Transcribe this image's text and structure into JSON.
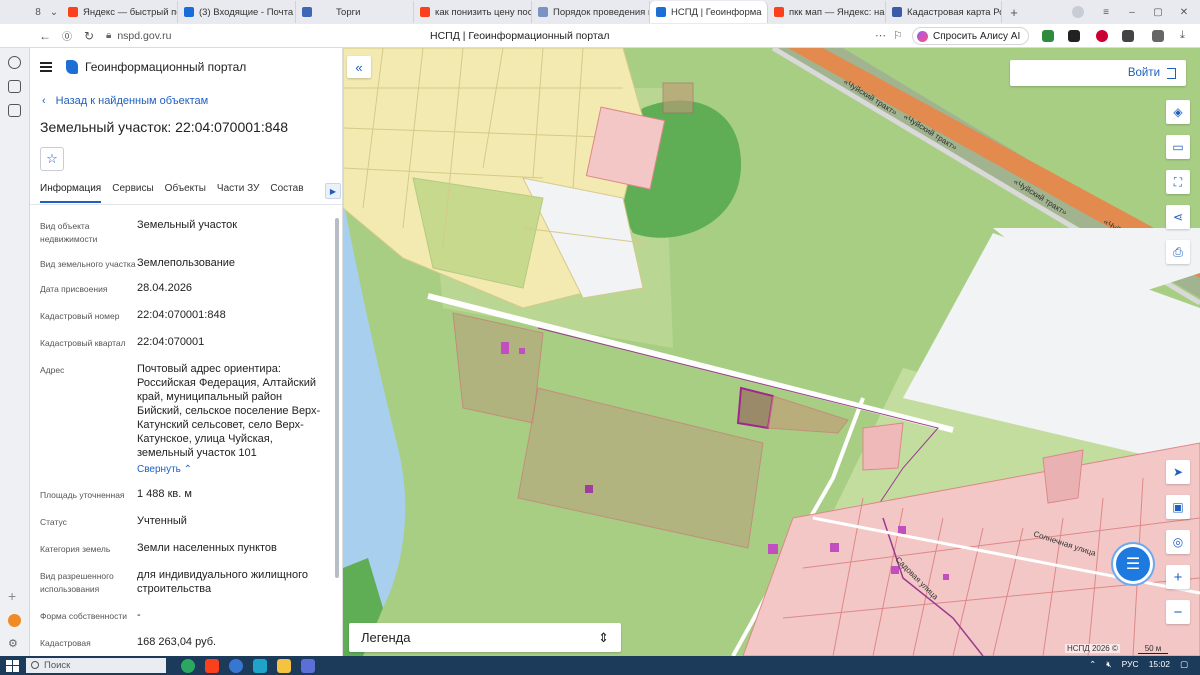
{
  "browser": {
    "tab_counter": "8",
    "tabs": [
      {
        "label": "Яндекс — быстрый пои",
        "color": "#fc3f1d"
      },
      {
        "label": "(3) Входящие - Почта М",
        "color": "#1a6cd8"
      },
      {
        "label": "Торги",
        "color": "#3e68b7"
      },
      {
        "label": "как понизить цену посл",
        "color": "#fc3f1d"
      },
      {
        "label": "Порядок проведения п",
        "color": "#7a93c4"
      },
      {
        "label": "НСПД | Геоинформа",
        "color": "#1d6fd6",
        "active": true
      },
      {
        "label": "пкк мап — Яндекс: наш",
        "color": "#fc3f1d"
      },
      {
        "label": "Кадастровая карта Рос",
        "color": "#3b5ba7"
      }
    ],
    "url": "nspd.gov.ru",
    "page_title": "НСПД | Геоинформационный портал",
    "alice_label": "Спросить Алису AI"
  },
  "app": {
    "brand": "Геоинформационный портал",
    "back_label": "Назад к найденным объектам",
    "object_title": "Земельный участок: 22:04:070001:848",
    "favorite_icon": "star-icon",
    "tabs": [
      "Информация",
      "Сервисы",
      "Объекты",
      "Части ЗУ",
      "Состав"
    ],
    "fields": [
      {
        "label": "Вид объекта недвижимости",
        "value": "Земельный участок"
      },
      {
        "label": "Вид земельного участка",
        "value": "Землепользование"
      },
      {
        "label": "Дата присвоения",
        "value": "28.04.2026"
      },
      {
        "label": "Кадастровый номер",
        "value": "22:04:070001:848"
      },
      {
        "label": "Кадастровый квартал",
        "value": "22:04:070001"
      },
      {
        "label": "Адрес",
        "value": "Почтовый адрес ориентира: Российская Федерация, Алтайский край, муниципальный район Бийский, сельское поселение Верх-Катунский сельсовет, село Верх-Катунское, улица Чуйская, земельный участок 101"
      },
      {
        "label": "Площадь уточненная",
        "value": "1 488 кв. м"
      },
      {
        "label": "Статус",
        "value": "Учтенный"
      },
      {
        "label": "Категория земель",
        "value": "Земли населенных пунктов"
      },
      {
        "label": "Вид разрешенного использования",
        "value": "для индивидуального жилищного строительства"
      },
      {
        "label": "Форма собственности",
        "value": "-"
      },
      {
        "label": "Кадастровая",
        "value": "168 263,04 руб."
      }
    ],
    "collapse_label": "Свернуть"
  },
  "map": {
    "login_label": "Войти",
    "legend_label": "Легенда",
    "copyright": "НСПД 2026 ©",
    "scale_label": "50 м",
    "streets": {
      "highway": "«Чуйский тракт»",
      "sun_street": "Солнечная улица",
      "garden_street": "Садовая улица"
    },
    "tools": [
      "layers-icon",
      "ruler-icon",
      "select-area-icon",
      "share-icon",
      "print-icon",
      "locate-icon",
      "screen-icon",
      "geo-search-icon",
      "zoom-in-icon",
      "zoom-out-icon"
    ]
  },
  "taskbar": {
    "search_placeholder": "Поиск",
    "language": "РУС",
    "time": "15:02"
  }
}
